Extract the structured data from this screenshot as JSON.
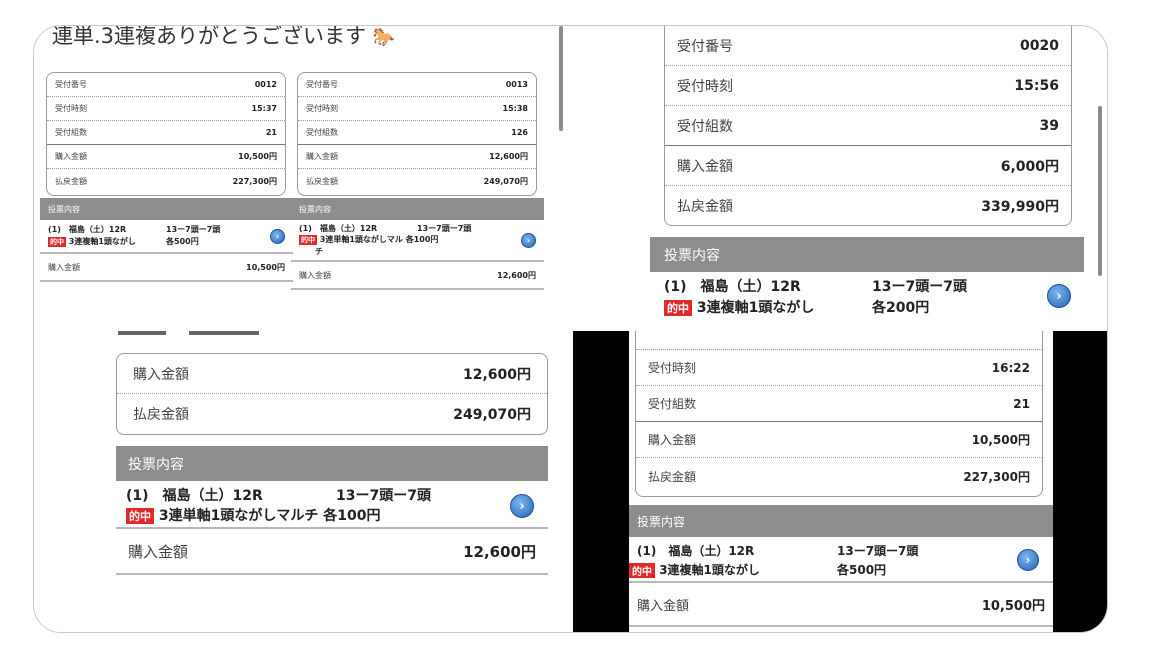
{
  "tl": {
    "heading": "連単.3連複ありがとうございます",
    "cards": [
      {
        "rows": [
          {
            "label": "受付番号",
            "value": "0012"
          },
          {
            "label": "受付時刻",
            "value": "15:37"
          },
          {
            "label": "受付組数",
            "value": "21"
          },
          {
            "label": "購入金額",
            "value": "10,500円"
          },
          {
            "label": "払戻金額",
            "value": "227,300円"
          }
        ],
        "section_header": "投票内容",
        "bet": {
          "line1": "(1)　福島（土）12R",
          "line1_right": "13ー7頭ー7頭",
          "badge": "的中",
          "line2": "3連複軸1頭ながし",
          "line2_right": "各500円"
        },
        "total": {
          "label": "購入金額",
          "value": "10,500円"
        }
      },
      {
        "rows": [
          {
            "label": "受付番号",
            "value": "0013"
          },
          {
            "label": "受付時刻",
            "value": "15:38"
          },
          {
            "label": "受付組数",
            "value": "126"
          },
          {
            "label": "購入金額",
            "value": "12,600円"
          },
          {
            "label": "払戻金額",
            "value": "249,070円"
          }
        ],
        "section_header": "投票内容",
        "bet": {
          "line1": "(1)　福島（土）12R",
          "line1_right": "13ー7頭ー7頭",
          "badge": "的中",
          "line2": "3連単軸1頭ながしマル 各100円",
          "line3": "チ"
        },
        "total": {
          "label": "購入金額",
          "value": "12,600円"
        }
      }
    ]
  },
  "tr": {
    "rows": [
      {
        "label": "受付番号",
        "value": "0020"
      },
      {
        "label": "受付時刻",
        "value": "15:56"
      },
      {
        "label": "受付組数",
        "value": "39"
      },
      {
        "label": "購入金額",
        "value": "6,000円"
      },
      {
        "label": "払戻金額",
        "value": "339,990円"
      }
    ],
    "section_header": "投票内容",
    "bet": {
      "line1": "(1)　福島（土）12R",
      "line1_right": "13ー7頭ー7頭",
      "badge": "的中",
      "line2": "3連複軸1頭ながし",
      "line2_right": "各200円"
    }
  },
  "bl": {
    "rows": [
      {
        "label": "購入金額",
        "value": "12,600円"
      },
      {
        "label": "払戻金額",
        "value": "249,070円"
      }
    ],
    "section_header": "投票内容",
    "bet": {
      "line1": "(1)　福島（土）12R",
      "line1_right": "13ー7頭ー7頭",
      "badge": "的中",
      "line2": "3連単軸1頭ながしマルチ 各100円"
    },
    "total": {
      "label": "購入金額",
      "value": "12,600円"
    }
  },
  "br": {
    "rows": [
      {
        "label": "受付時刻",
        "value": "16:22"
      },
      {
        "label": "受付組数",
        "value": "21"
      },
      {
        "label": "購入金額",
        "value": "10,500円"
      },
      {
        "label": "払戻金額",
        "value": "227,300円"
      }
    ],
    "section_header": "投票内容",
    "bet": {
      "line1": "(1)　福島（土）12R",
      "line1_right": "13ー7頭ー7頭",
      "badge": "的中",
      "line2": "3連複軸1頭ながし",
      "line2_right": "各500円"
    },
    "total": {
      "label": "購入金額",
      "value": "10,500円"
    }
  },
  "icons": {
    "horse": "horse-emoji-icon",
    "detail": "chevron-right-circle-icon"
  },
  "colors": {
    "badge": "#e02a2a",
    "header": "#8d8d8d",
    "icon": "#2563b8",
    "black_bg": "#000000"
  }
}
